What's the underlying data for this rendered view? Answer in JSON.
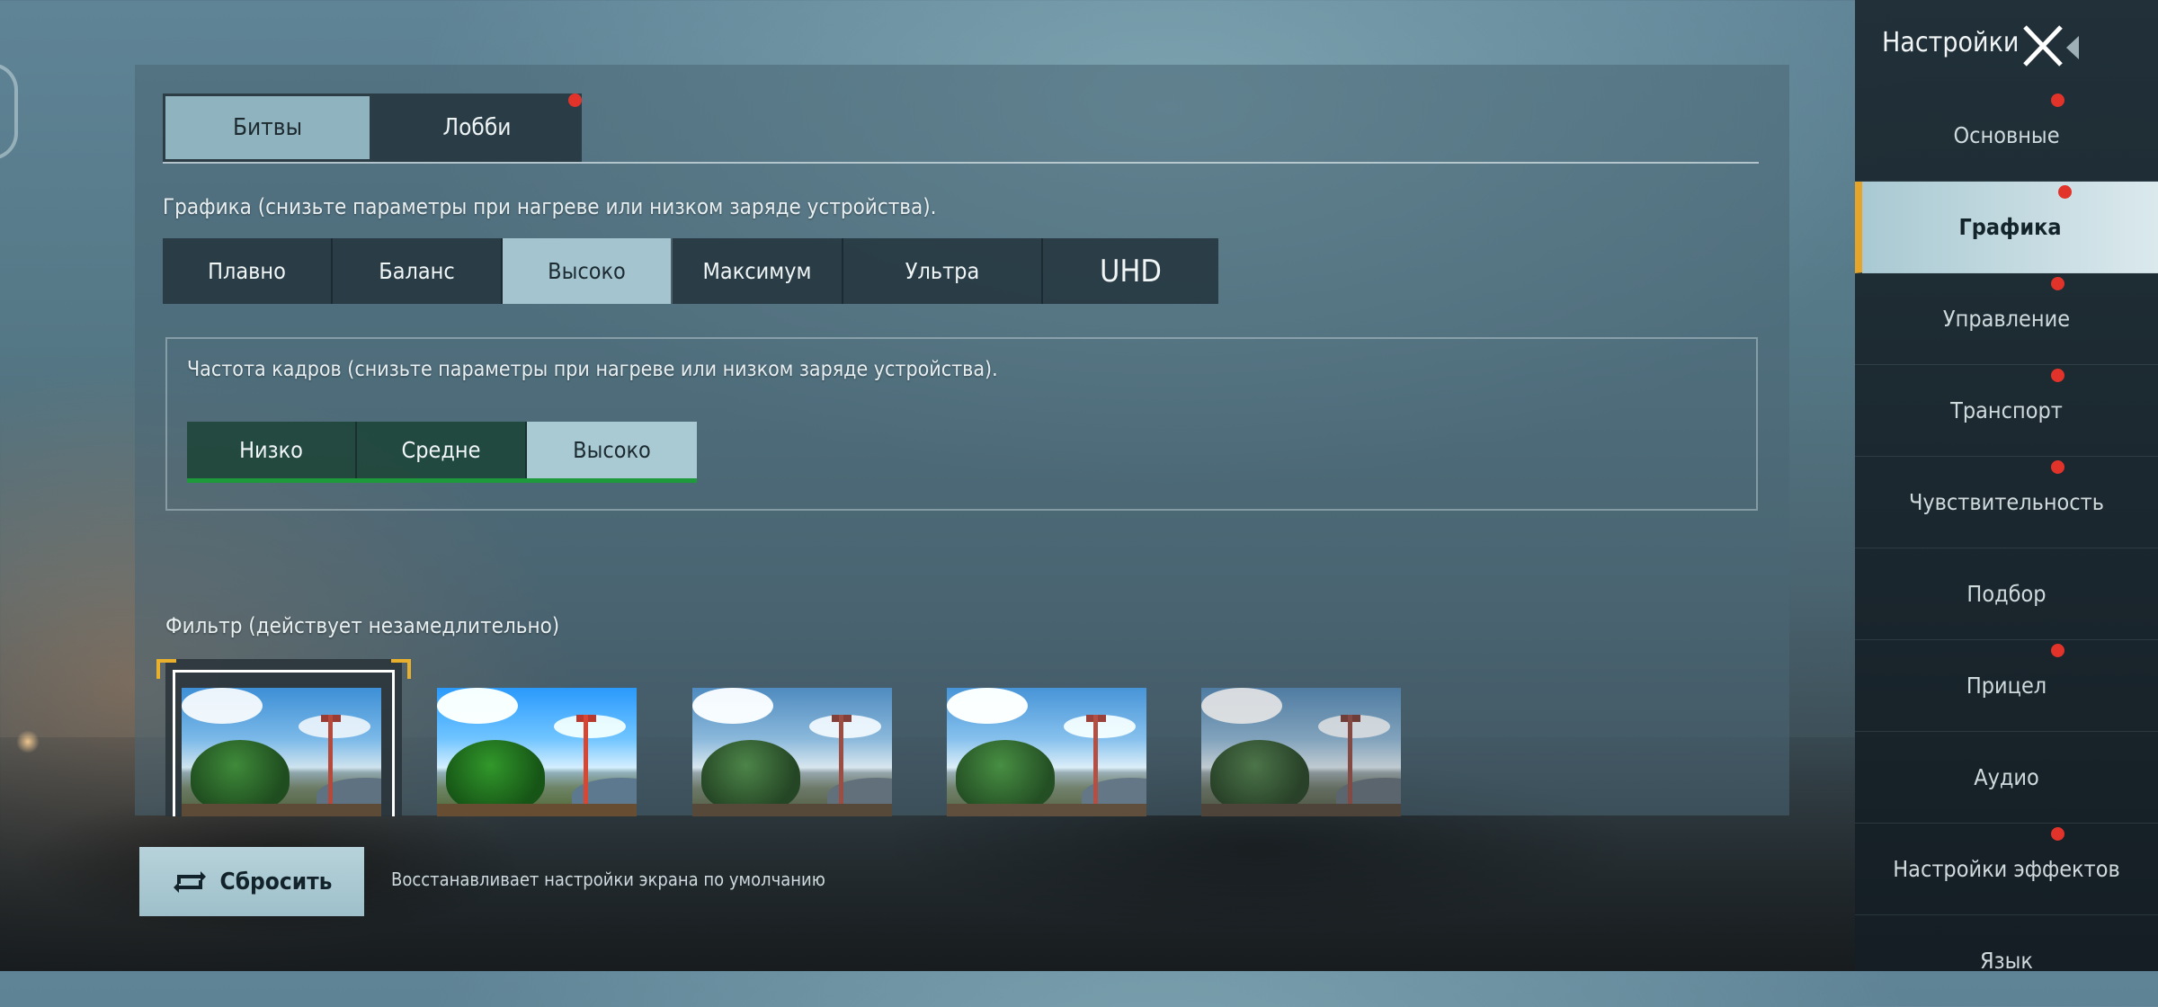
{
  "mode_tabs": [
    {
      "label": "Битвы",
      "active": true,
      "badge": false
    },
    {
      "label": "Лобби",
      "active": false,
      "badge": true
    }
  ],
  "graphics": {
    "title": "Графика (снизьте параметры при нагреве или низком заряде устройства).",
    "options": [
      "Плавно",
      "Баланс",
      "Высоко",
      "Максимум",
      "Ультра",
      "UHD"
    ],
    "selected": "Высоко"
  },
  "fps": {
    "title": "Частота кадров (снизьте параметры при нагреве или низком заряде устройства).",
    "options": [
      "Низко",
      "Средне",
      "Высоко"
    ],
    "selected": "Высоко"
  },
  "filter": {
    "title": "Фильтр (действует незамедлительно)",
    "thumbnails": [
      "filter-1",
      "filter-2",
      "filter-3",
      "filter-4",
      "filter-5"
    ],
    "selected_index": 0
  },
  "bottom": {
    "reset_label": "Сбросить",
    "reset_hint": "Восстанавливает настройки экрана по умолчанию"
  },
  "sidebar": {
    "title": "Настройки",
    "close_icon": "close-back-icon",
    "items": [
      {
        "label": "Основные",
        "active": false,
        "badge": true
      },
      {
        "label": "Графика",
        "active": true,
        "badge": true
      },
      {
        "label": "Управление",
        "active": false,
        "badge": true
      },
      {
        "label": "Транспорт",
        "active": false,
        "badge": true
      },
      {
        "label": "Чувствительность",
        "active": false,
        "badge": true
      },
      {
        "label": "Подбор",
        "active": false,
        "badge": false
      },
      {
        "label": "Прицел",
        "active": false,
        "badge": true
      },
      {
        "label": "Аудио",
        "active": false,
        "badge": false
      },
      {
        "label": "Настройки эффектов",
        "active": false,
        "badge": true
      },
      {
        "label": "Язык",
        "active": false,
        "badge": false
      }
    ]
  },
  "colors": {
    "accent": "#e5a52a",
    "badge": "#e2332b",
    "selected_tab": "#a4c5cf",
    "fps_underline": "#1e9a3c"
  }
}
